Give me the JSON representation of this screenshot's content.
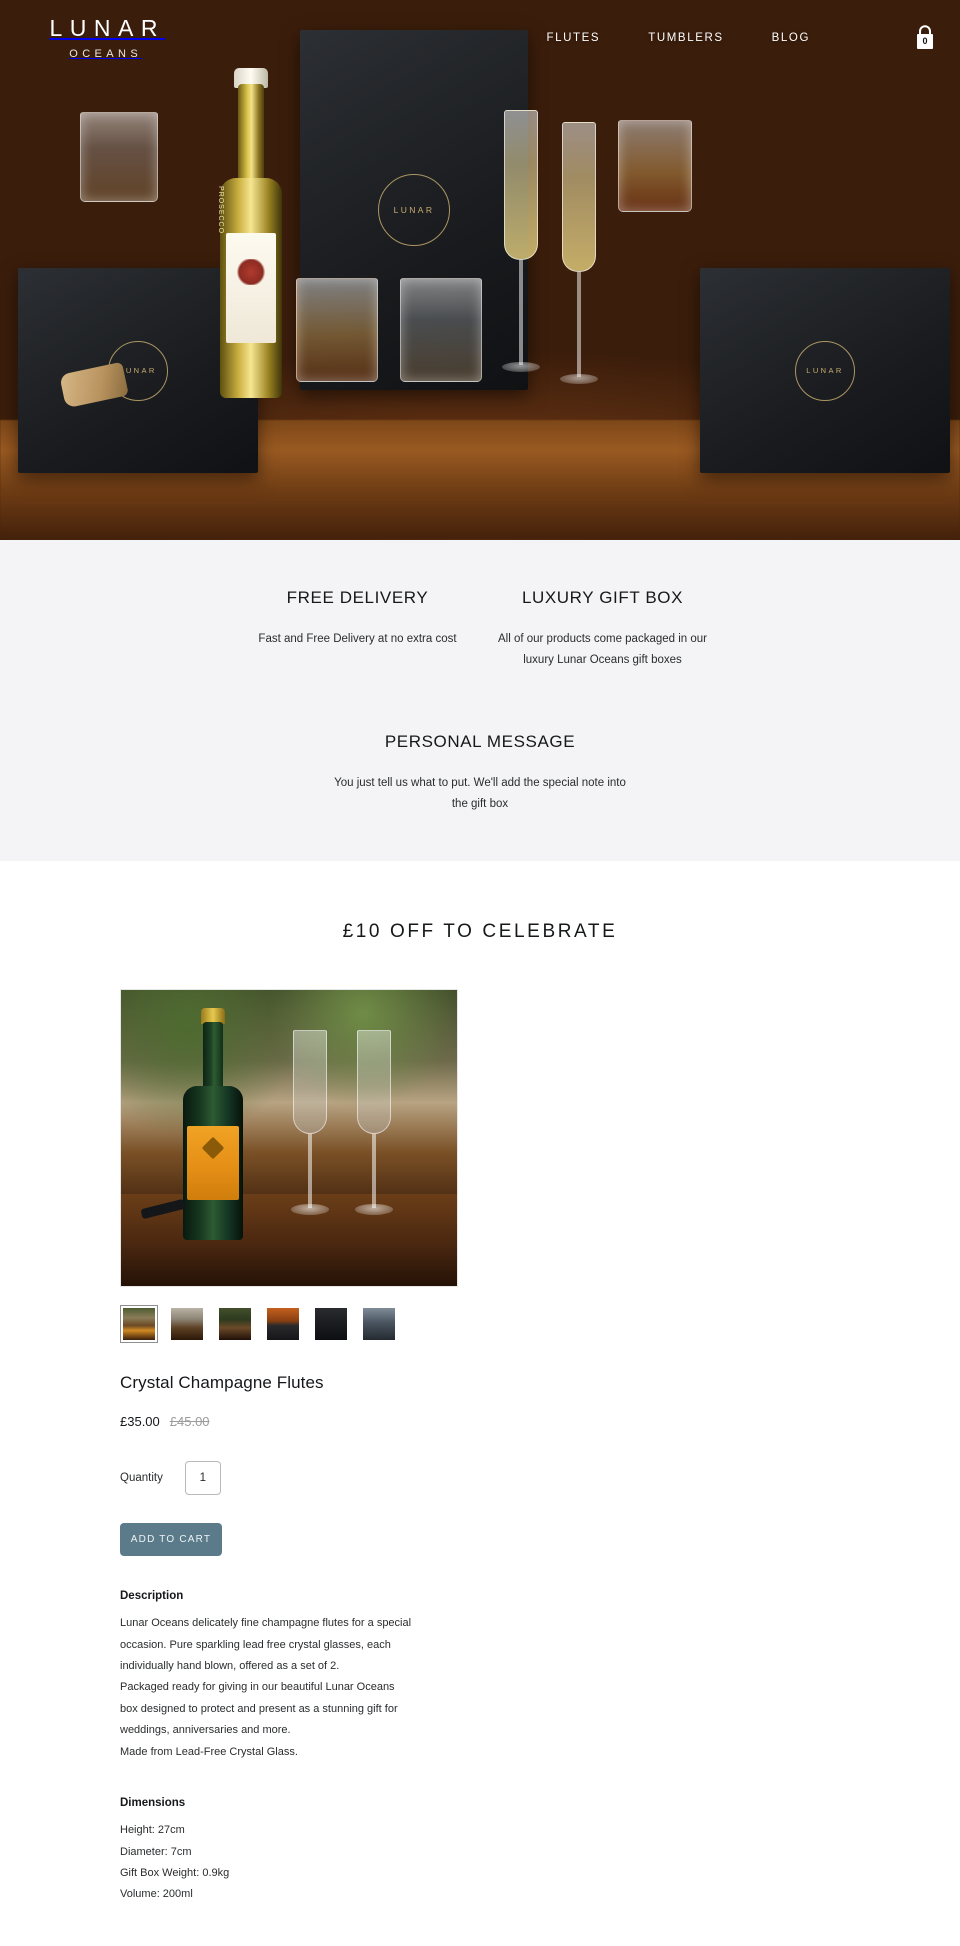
{
  "header": {
    "brand_main": "LUNAR",
    "brand_sub": "OCEANS",
    "nav": [
      {
        "label": "FLUTES"
      },
      {
        "label": "TUMBLERS"
      },
      {
        "label": "BLOG"
      }
    ],
    "cart_count": "0"
  },
  "hero": {
    "box_ring_label": "LUNAR",
    "bottle_vertical_text": "PROSECCO"
  },
  "features": [
    {
      "title": "FREE DELIVERY",
      "text": "Fast and Free Delivery at no extra cost"
    },
    {
      "title": "LUXURY GIFT BOX",
      "text": "All of our products come packaged in our luxury Lunar Oceans gift boxes"
    },
    {
      "title": "PERSONAL MESSAGE",
      "text": "You just tell us what to put. We'll add the special note into the gift box"
    }
  ],
  "promo": {
    "title": "£10 OFF TO CELEBRATE"
  },
  "product": {
    "title": "Crystal Champagne Flutes",
    "price_current": "£35.00",
    "price_original": "£45.00",
    "quantity_label": "Quantity",
    "quantity_value": "1",
    "add_to_cart_label": "ADD TO CART",
    "thumbnails": [
      {
        "alt": "champagne-bottle-and-flutes-on-table",
        "selected": true
      },
      {
        "alt": "bottle-with-flutes-light-background",
        "selected": false
      },
      {
        "alt": "flutes-with-foliage-backdrop",
        "selected": false
      },
      {
        "alt": "flutes-in-open-gift-box-on-wood",
        "selected": false
      },
      {
        "alt": "closed-black-gift-box",
        "selected": false
      },
      {
        "alt": "flutes-pair-grey-backdrop",
        "selected": false
      }
    ],
    "description_heading": "Description",
    "description_lines": [
      "Lunar Oceans delicately fine champagne flutes for a special occasion. Pure sparkling lead free crystal glasses, each individually hand blown, offered as a set of 2.",
      "Packaged ready for giving in our beautiful Lunar Oceans box designed to protect and present as a stunning gift for weddings, anniversaries and more.",
      "Made from Lead-Free Crystal Glass."
    ],
    "dimensions_heading": "Dimensions",
    "dimensions_lines": [
      "Height: 27cm",
      "Diameter: 7cm",
      "Gift Box Weight: 0.9kg",
      "Volume: 200ml"
    ]
  },
  "colors": {
    "accent_button": "#5b7b8a",
    "features_background": "#f4f4f6",
    "text_primary": "#15171a",
    "price_strikethrough": "#9b9b9b"
  }
}
